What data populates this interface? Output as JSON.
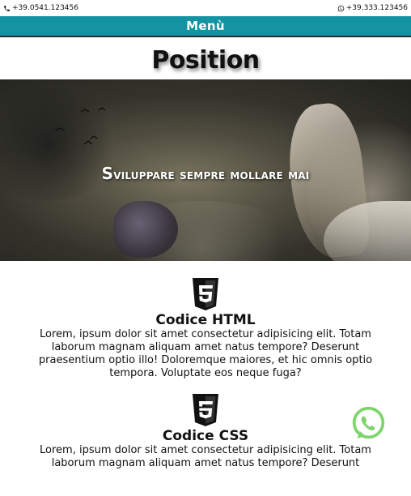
{
  "topbar": {
    "phone": "+39.0541.123456",
    "whatsapp": "+39.333.123456"
  },
  "menu": {
    "label": "Menù"
  },
  "page": {
    "title": "Position"
  },
  "hero": {
    "headline": "Sviluppare sempre mollare mai"
  },
  "features": [
    {
      "icon": "html5-icon",
      "title": "Codice HTML",
      "text": "Lorem, ipsum dolor sit amet consectetur adipisicing elit. Totam laborum magnam aliquam amet natus tempore? Deserunt praesentium optio illo! Doloremque maiores, et hic omnis optio tempora. Voluptate eos neque fuga?"
    },
    {
      "icon": "css3-icon",
      "title": "Codice CSS",
      "text": "Lorem, ipsum dolor sit amet consectetur adipisicing elit. Totam laborum magnam aliquam amet natus tempore? Deserunt"
    }
  ],
  "colors": {
    "menu_bg": "#1493a3",
    "whatsapp": "#7fd46b"
  }
}
